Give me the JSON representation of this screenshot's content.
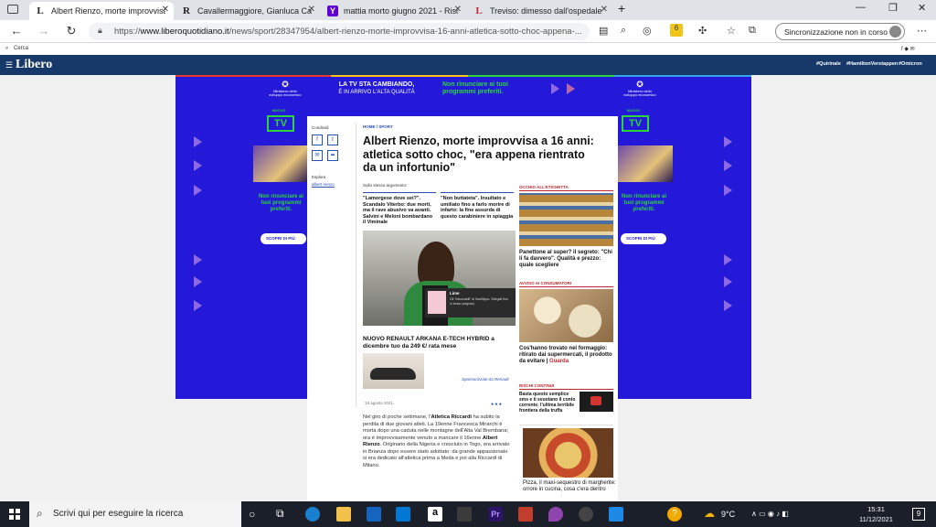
{
  "tabs": [
    {
      "favicon": "L",
      "title": "Albert Rienzo, morte improvvisa",
      "active": true
    },
    {
      "favicon": "R",
      "title": "Cavallermaggiore, Gianluca Casa",
      "active": false
    },
    {
      "favicon": "Y",
      "title": "mattia morto giugno 2021 - Risu",
      "active": false
    },
    {
      "favicon": "L",
      "title": "Treviso: dimesso dall'ospedale d",
      "active": false
    }
  ],
  "address": {
    "prefix": "https://",
    "domain": "www.liberoquotidiano.it",
    "path": "/news/sport/28347954/albert-rienzo-morte-improvvisa-16-anni-atletica-sotto-choc-appena-..."
  },
  "sync_label": "Sincronizzazione non in corso",
  "favbar_label": "Cerca",
  "site": {
    "logo": "Libero",
    "hashtags": [
      "#Quirinale",
      "#HamiltonVerstappen",
      "#Omicron"
    ]
  },
  "ad": {
    "headline_left": "LA TV STA CAMBIANDO,",
    "headline_left2": "È IN ARRIVO L'ALTA QUALITÀ",
    "headline_right": "Non rinunciare ai tuoi",
    "headline_right2": "programmi preferiti.",
    "ministry": "Ministero dello sviluppo economico",
    "tv_label": "TV",
    "tv_top": "NUOVO",
    "side_text": "Non rinunciare ai tuoi programmi preferiti.",
    "cta": "SCOPRI DI PIÙ"
  },
  "article": {
    "condividi": "Condividi",
    "esplora": "Esplora",
    "tag": "albert rienzo",
    "breadcrumb": "HOME / SPORT",
    "title": "Albert Rienzo, morte improvvisa a 16 anni: atletica sotto choc, \"era appena rientrato da un infortunio\"",
    "related_label": "Sullo stesso argomento:",
    "related": [
      "\"Lamorgese dove sei?\". Scandalo Viterbo: due morti, ma il rave abusivo va avanti. Salvini e Meloni bombardano il Viminale",
      "\"Non buttateta\". Insultato e umiliato fino a farlo morire di infarto: la fine assurda di questo carabiniere in spiaggia"
    ],
    "video_title": "Lime",
    "video_sub": "Gli \"Intoccabili\" di Sanfilippo. Sbirgati fino in fondo (seguito)",
    "promo_title": "NUOVO RENAULT ARKANA E-TECH HYBRID a dicembre tuo da 249 €/ rata mese",
    "promo_sponsor": "Sponsorizzato da Renault",
    "date": "18 agosto 2021",
    "body_html": [
      "Nel giro di poche settimane, l'",
      "Atletica Riccardi",
      " ha subito la perdita di due giovani atleti. La 19enne Francesca Mirarchi è morta dopo una caduta nelle montagne dell'Alta Val Brembana; ora è improvvisamente venuto a mancare il 16enne ",
      "Albert Rienzo",
      ". Originario della Nigeria e cresciuto in Togo, era arrivato in Brianza dopo essere stato adottato: da grande appassionato si era dedicato all'atletica prima a Meda e poi alla Riccardi di Milano."
    ]
  },
  "sidebar": [
    {
      "section": "OCCHIO ALL'ETICHETTA",
      "title": "Panettone al super? il segreto: \"Chi li fa davvero\". Qualità e prezzo: quale scegliere"
    },
    {
      "section": "AVVISO AI CONSUMATORI",
      "title": "Cos'hanno trovato nel formaggio: ritirato dai supermercati, il prodotto da evitare",
      "link": "Guarda"
    },
    {
      "section": "RISCHI CONTINUI",
      "title": "Basta questo semplice sms e ti svuotano il conto corrente: l'ultima terribile frontiera della truffa"
    },
    {
      "title": "Pizza, il maxi-sequestro di margherite: orrore in cucina, cosa c'era dentro"
    }
  ],
  "taskbar": {
    "search": "Scrivi qui per eseguire la ricerca",
    "temp": "9°C",
    "time": "15:31",
    "date": "11/12/2021",
    "notif": "9"
  },
  "colors": {
    "ad_blue": "#2419d8",
    "libero_navy": "#16396a",
    "accent_red": "#c0272d",
    "green": "#2cd53e"
  }
}
